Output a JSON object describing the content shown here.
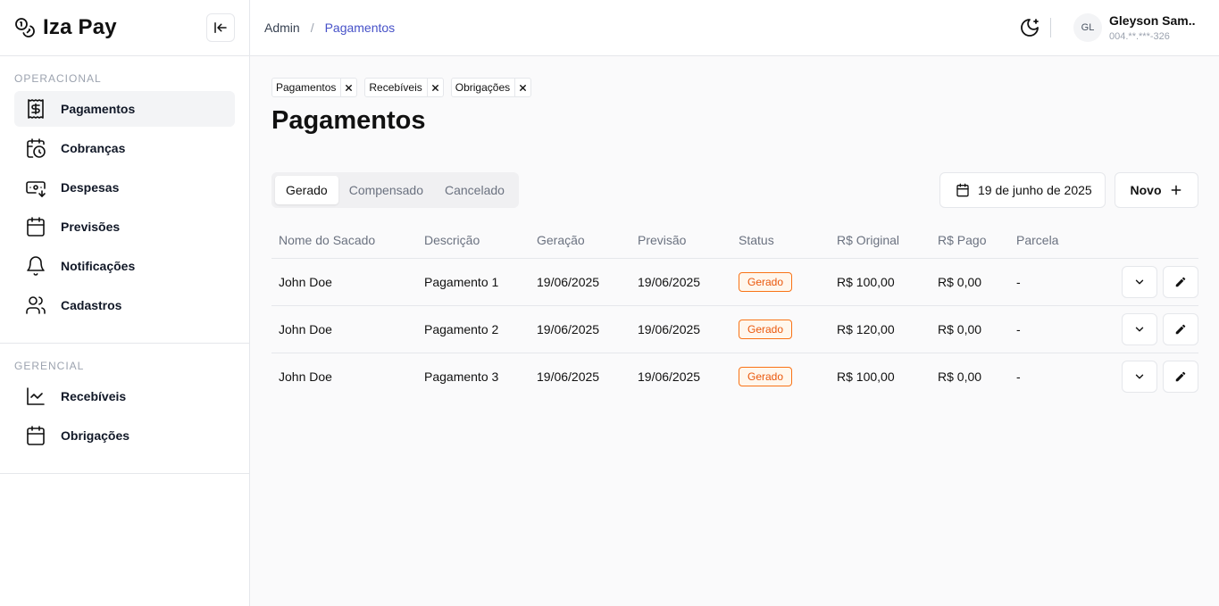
{
  "app": {
    "name": "Iza Pay"
  },
  "sidebar": {
    "sections": [
      {
        "title": "OPERACIONAL",
        "items": [
          {
            "label": "Pagamentos",
            "icon": "dollar-receipt-icon",
            "active": true
          },
          {
            "label": "Cobranças",
            "icon": "calendar-clock-icon"
          },
          {
            "label": "Despesas",
            "icon": "money-out-icon"
          },
          {
            "label": "Previsões",
            "icon": "calendar-icon"
          },
          {
            "label": "Notificações",
            "icon": "bell-icon"
          },
          {
            "label": "Cadastros",
            "icon": "users-icon"
          }
        ]
      },
      {
        "title": "GERENCIAL",
        "items": [
          {
            "label": "Recebíveis",
            "icon": "line-chart-icon"
          },
          {
            "label": "Obrigações",
            "icon": "calendar-icon"
          }
        ]
      }
    ]
  },
  "breadcrumb": {
    "root": "Admin",
    "separator": "/",
    "current": "Pagamentos"
  },
  "user": {
    "initials": "GL",
    "name": "Gleyson Sam...",
    "document": "004.**.***-326"
  },
  "open_tabs": [
    "Pagamentos",
    "Recebíveis",
    "Obrigações"
  ],
  "page": {
    "title": "Pagamentos"
  },
  "status_tabs": [
    {
      "label": "Gerado",
      "active": true
    },
    {
      "label": "Compensado"
    },
    {
      "label": "Cancelado"
    }
  ],
  "date_filter": "19 de junho de 2025",
  "new_button": "Novo",
  "table": {
    "headers": [
      "Nome do Sacado",
      "Descrição",
      "Geração",
      "Previsão",
      "Status",
      "R$ Original",
      "R$ Pago",
      "Parcela"
    ],
    "rows": [
      [
        "John Doe",
        "Pagamento 1",
        "19/06/2025",
        "19/06/2025",
        "Gerado",
        "R$ 100,00",
        "R$ 0,00",
        "-"
      ],
      [
        "John Doe",
        "Pagamento 2",
        "19/06/2025",
        "19/06/2025",
        "Gerado",
        "R$ 120,00",
        "R$ 0,00",
        "-"
      ],
      [
        "John Doe",
        "Pagamento 3",
        "19/06/2025",
        "19/06/2025",
        "Gerado",
        "R$ 100,00",
        "R$ 0,00",
        "-"
      ]
    ]
  },
  "colors": {
    "accent": "#4651c8",
    "status_generated": "#ea580c",
    "border": "#e5e7eb"
  }
}
